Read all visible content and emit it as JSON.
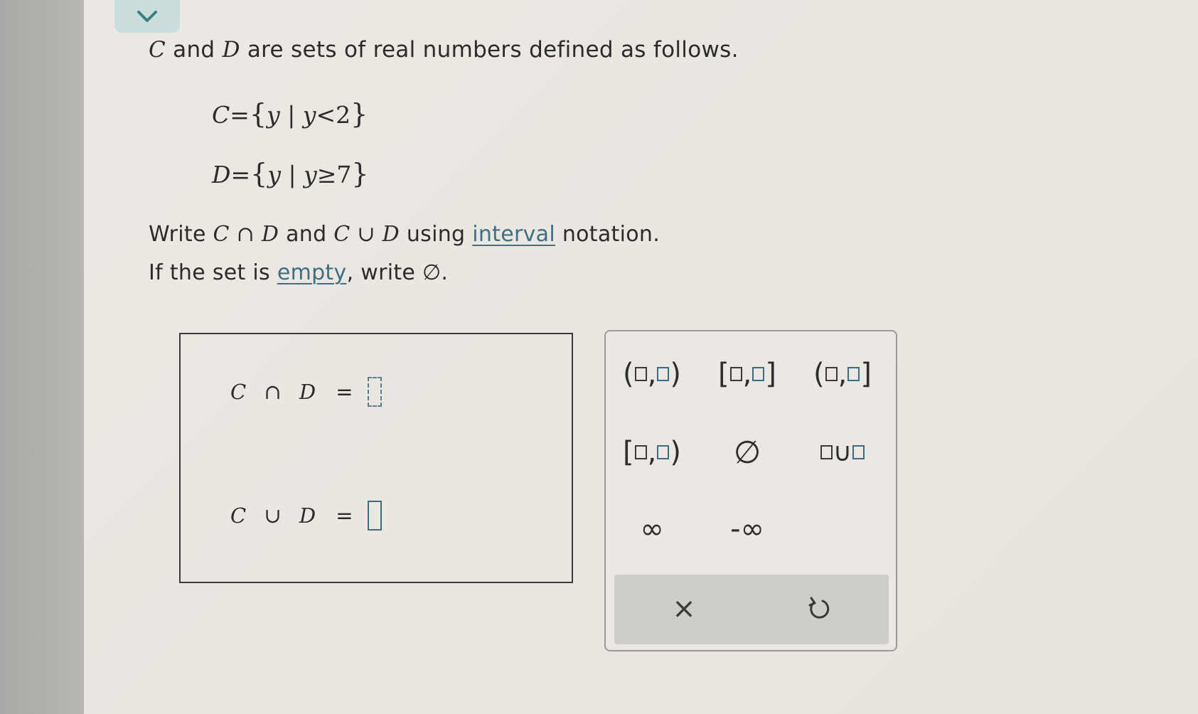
{
  "intro": {
    "set1": "C",
    "and": " and ",
    "set2": "D",
    "rest": " are sets of real numbers defined as follows."
  },
  "definitions": {
    "c": {
      "name": "C",
      "eq": "=",
      "open": "{",
      "var": "y",
      "bar": " | ",
      "cond_var": "y",
      "cond": "<2",
      "close": "}"
    },
    "d": {
      "name": "D",
      "eq": "=",
      "open": "{",
      "var": "y",
      "bar": " | ",
      "cond_var": "y",
      "cond": "≥7",
      "close": "}"
    }
  },
  "question": {
    "write": "Write ",
    "expr1": "C ∩ D",
    "and": " and ",
    "expr2": "C ∪ D",
    "using": " using ",
    "link": "interval",
    "end": " notation."
  },
  "question2": {
    "prefix": "If the set is ",
    "link": "empty",
    "suffix": ", write ∅."
  },
  "answers": [
    {
      "label": "C ∩ D",
      "eq": "=",
      "value": ""
    },
    {
      "label": "C ∪ D",
      "eq": "=",
      "value": ""
    }
  ],
  "palette": {
    "open_open": {
      "left": "(",
      "comma": ",",
      "right": ")"
    },
    "closed_closed": {
      "left": "[",
      "comma": ",",
      "right": "]"
    },
    "open_closed": {
      "left": "(",
      "comma": ",",
      "right": "]"
    },
    "closed_open": {
      "left": "[",
      "comma": ",",
      "right": ")"
    },
    "empty_set": "∅",
    "union": "∪",
    "infinity": "∞",
    "neg_infinity": "-∞",
    "clear": "×",
    "undo_icon": "undo-icon"
  }
}
